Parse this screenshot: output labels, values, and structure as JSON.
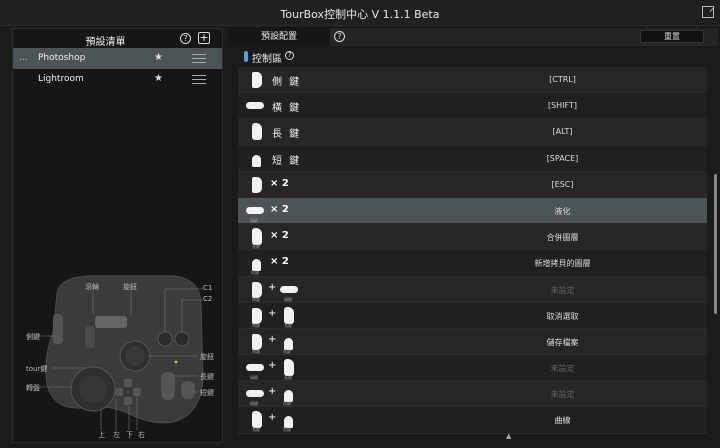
{
  "app": {
    "title": "TourBox控制中心 V 1.1.1 Beta"
  },
  "left_panel": {
    "title": "預設清單",
    "help_glyph": "?",
    "add_glyph": "+",
    "presets": [
      {
        "name": "Photoshop",
        "dots": "...",
        "star": "★",
        "active": true
      },
      {
        "name": "Lightroom",
        "star": "★",
        "active": false
      }
    ],
    "device_labels": {
      "scroll": "滾輪",
      "knob": "旋鈕",
      "c1": "C1",
      "c2": "C2",
      "side": "側鍵",
      "tour": "tour鍵",
      "turntable": "轉盤",
      "dial": "旋鈕",
      "long": "長鍵",
      "short": "短鍵",
      "up": "上",
      "left": "左",
      "down": "下",
      "right": "右"
    }
  },
  "right_panel": {
    "tab_label": "預設配置",
    "help_glyph": "?",
    "reset_label": "重置",
    "section_label": "控制區",
    "rows": [
      {
        "keys": "側鍵",
        "function": "[CTRL]"
      },
      {
        "keys": "橫鍵",
        "function": "[SHIFT]"
      },
      {
        "keys": "長鍵",
        "function": "[ALT]"
      },
      {
        "keys": "短鍵",
        "function": "[SPACE]"
      },
      {
        "keys": "側鍵 × 2",
        "function": "[ESC]"
      },
      {
        "keys": "橫鍵 × 2",
        "function": "液化",
        "selected": true
      },
      {
        "keys": "長鍵 × 2",
        "function": "合併圖層"
      },
      {
        "keys": "短鍵 × 2",
        "function": "新增拷貝的圖層"
      },
      {
        "keys": "側鍵 + 橫鍵",
        "function": "未設定",
        "dim": true
      },
      {
        "keys": "側鍵 + 長鍵",
        "function": "取消選取"
      },
      {
        "keys": "側鍵 + 短鍵",
        "function": "儲存檔案"
      },
      {
        "keys": "橫鍵 + 長鍵",
        "function": "未設定",
        "dim": true
      },
      {
        "keys": "橫鍵 + 短鍵",
        "function": "未設定",
        "dim": true
      },
      {
        "keys": "長鍵 + 短鍵",
        "function": "曲線"
      }
    ],
    "multiplier": "× 2",
    "plus": "+",
    "key_words": {
      "side": "側 鍵",
      "bar": "橫 鍵",
      "long": "長 鍵",
      "short": "短 鍵"
    },
    "key_tiny": {
      "side": "側鍵",
      "bar": "橫鍵",
      "long": "長鍵",
      "short": "短鍵"
    }
  },
  "colors": {
    "accent": "#5a9de0",
    "selected_row": "#4c5457",
    "panel_bg": "#161616"
  }
}
